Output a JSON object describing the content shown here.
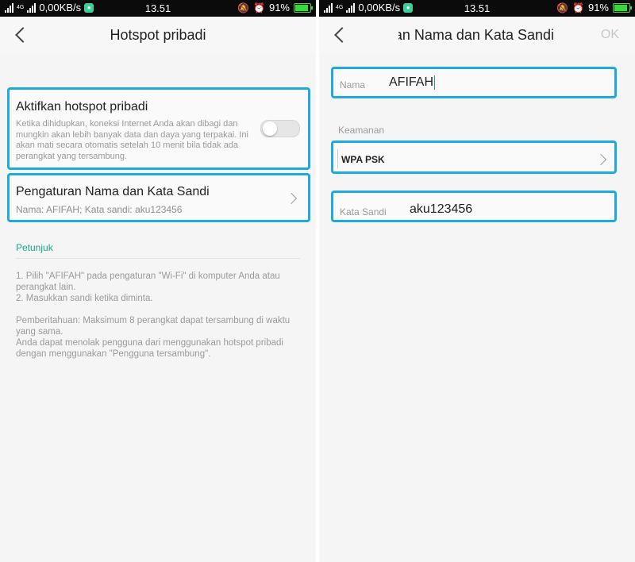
{
  "status_bar": {
    "net": "4G",
    "speed": "0,00KB/s",
    "time": "13.51",
    "battery_percent": "91%",
    "battery_level": 0.91
  },
  "left": {
    "title": "Hotspot pribadi",
    "toggle_item": {
      "title": "Aktifkan hotspot pribadi",
      "description": "Ketika dihidupkan, koneksi Internet Anda akan dibagi dan mungkin akan lebih banyak data dan daya yang terpakai. Ini akan mati secara otomatis setelah 10 menit bila tidak ada perangkat yang tersambung.",
      "enabled": false
    },
    "name_item": {
      "title": "Pengaturan Nama dan Kata Sandi",
      "subtitle": "Nama: AFIFAH; Kata sandi: aku123456"
    },
    "hint": {
      "title": "Petunjuk",
      "paragraph1": "1. Pilih \"AFIFAH\" pada pengaturan \"Wi-Fi\" di komputer Anda atau perangkat lain.\n2. Masukkan sandi ketika diminta.",
      "paragraph2": "Pemberitahuan: Maksimum 8 perangkat dapat tersambung di waktu yang sama.\nAnda dapat menolak pengguna dari menggunakan hotspot pribadi dengan menggunakan \"Pengguna tersambung\"."
    }
  },
  "right": {
    "title": "Pengaturan Nama dan Kata Sandi",
    "ok_label": "OK",
    "name_label": "Nama",
    "name_value": "AFIFAH",
    "security_section": "Keamanan",
    "security_value": "WPA PSK",
    "password_label": "Kata Sandi",
    "password_value": "aku123456"
  },
  "colors": {
    "highlight": "#1ea9e1",
    "accent": "#1ba58d"
  }
}
